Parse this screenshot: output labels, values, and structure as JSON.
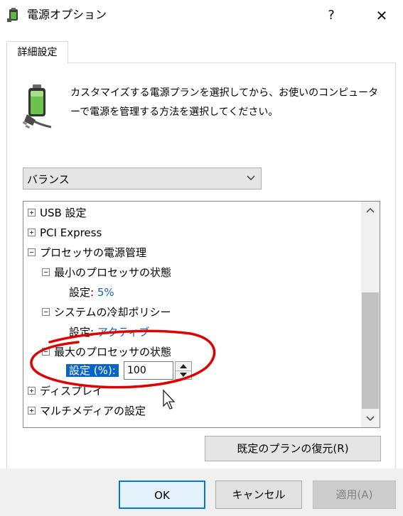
{
  "window": {
    "title": "電源オプション",
    "help_label": "?",
    "close_label": "✕",
    "icon": "power-options-icon"
  },
  "tabs": [
    {
      "label": "詳細設定",
      "selected": true
    }
  ],
  "description": "カスタマイズする電源プランを選択してから、お使いのコンピューターで電源を管理する方法を選択してください。",
  "plan_select": {
    "value": "バランス",
    "icon": "chevron-down-icon"
  },
  "tree": {
    "items": [
      {
        "label": "USB 設定",
        "state": "collapsed"
      },
      {
        "label": "PCI Express",
        "state": "collapsed"
      },
      {
        "label": "プロセッサの電源管理",
        "state": "expanded"
      },
      {
        "label": "最小のプロセッサの状態",
        "state": "expanded",
        "setting_label": "設定:",
        "setting_value": "5%"
      },
      {
        "label": "システムの冷却ポリシー",
        "state": "expanded",
        "setting_label": "設定:",
        "setting_value": "アクティブ"
      },
      {
        "label": "最大のプロセッサの状態",
        "state": "expanded",
        "setting_label": "設定 (%):",
        "setting_value": "100"
      },
      {
        "label": "ディスプレイ",
        "state": "collapsed"
      },
      {
        "label": "マルチメディアの設定",
        "state": "collapsed"
      }
    ]
  },
  "buttons": {
    "restore": "既定のプランの復元(R)",
    "ok": "OK",
    "cancel": "キャンセル",
    "apply": "適用(A)"
  },
  "colors": {
    "accent": "#0078d7",
    "selection": "#0a64c8",
    "link": "#1a5fb4",
    "annotation": "#e00000"
  }
}
